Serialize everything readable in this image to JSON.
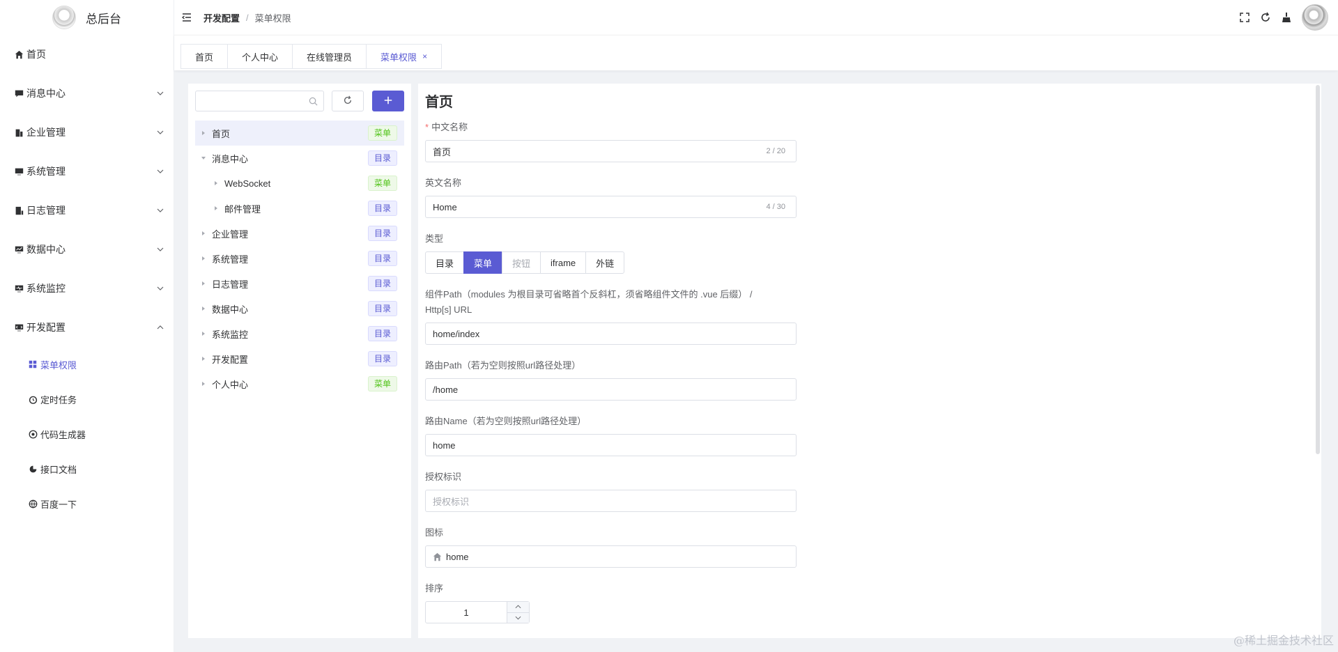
{
  "app": {
    "title": "总后台"
  },
  "sidebar": {
    "items": [
      {
        "label": "首页",
        "icon": "home-icon"
      },
      {
        "label": "消息中心",
        "icon": "message-icon"
      },
      {
        "label": "企业管理",
        "icon": "building-icon"
      },
      {
        "label": "系统管理",
        "icon": "monitor-icon"
      },
      {
        "label": "日志管理",
        "icon": "log-icon"
      },
      {
        "label": "数据中心",
        "icon": "data-icon"
      },
      {
        "label": "系统监控",
        "icon": "monitor-icon"
      },
      {
        "label": "开发配置",
        "icon": "dev-icon"
      }
    ],
    "sub_items": [
      {
        "label": "菜单权限",
        "icon": "grid-icon"
      },
      {
        "label": "定时任务",
        "icon": "alarm-icon"
      },
      {
        "label": "代码生成器",
        "icon": "code-icon"
      },
      {
        "label": "接口文档",
        "icon": "api-icon"
      },
      {
        "label": "百度一下",
        "icon": "globe-icon"
      }
    ]
  },
  "header": {
    "breadcrumb": [
      "开发配置",
      "菜单权限"
    ],
    "separator": "/"
  },
  "tabs": [
    {
      "label": "首页"
    },
    {
      "label": "个人中心"
    },
    {
      "label": "在线管理员"
    },
    {
      "label": "菜单权限",
      "close": "×"
    }
  ],
  "tree": {
    "search_placeholder": "",
    "nodes": [
      {
        "label": "首页",
        "tag": "菜单"
      },
      {
        "label": "消息中心",
        "tag": "目录"
      },
      {
        "label": "WebSocket",
        "tag": "菜单"
      },
      {
        "label": "邮件管理",
        "tag": "目录"
      },
      {
        "label": "企业管理",
        "tag": "目录"
      },
      {
        "label": "系统管理",
        "tag": "目录"
      },
      {
        "label": "日志管理",
        "tag": "目录"
      },
      {
        "label": "数据中心",
        "tag": "目录"
      },
      {
        "label": "系统监控",
        "tag": "目录"
      },
      {
        "label": "开发配置",
        "tag": "目录"
      },
      {
        "label": "个人中心",
        "tag": "菜单"
      }
    ]
  },
  "form": {
    "title": "首页",
    "name_cn": {
      "required_mark": "*",
      "label": "中文名称",
      "value": "首页",
      "count": "2 / 20"
    },
    "name_en": {
      "label": "英文名称",
      "value": "Home",
      "count": "4 / 30"
    },
    "type": {
      "label": "类型",
      "options": [
        "目录",
        "菜单",
        "按钮",
        "iframe",
        "外链"
      ],
      "selected": "菜单"
    },
    "component": {
      "label_line1": "组件Path（modules 为根目录可省略首个反斜杠，须省略组件文件的 .vue 后缀）  /",
      "label_line2": "Http[s] URL",
      "value": "home/index"
    },
    "route_path": {
      "label": "路由Path（若为空则按照url路径处理）",
      "value": "/home"
    },
    "route_name": {
      "label": "路由Name（若为空则按照url路径处理）",
      "value": "home"
    },
    "auth": {
      "label": "授权标识",
      "placeholder": "授权标识"
    },
    "icon": {
      "label": "图标",
      "value": "home"
    },
    "sort": {
      "label": "排序",
      "value": "1"
    }
  },
  "watermark": "@稀土掘金技术社区",
  "colors": {
    "primary": "#5a5bd3",
    "menu_tag": "#52c41a",
    "dir_tag": "#5a5bd3"
  }
}
